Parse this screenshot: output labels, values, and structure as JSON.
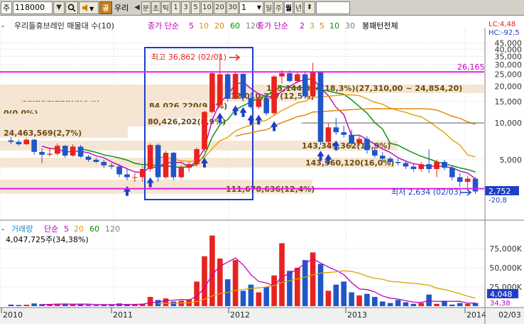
{
  "toolbar": {
    "market": "주",
    "code": "118000",
    "search_icon": "magnifier-icon",
    "sound_icon": "speaker-icon",
    "gong": "공",
    "name": "우리",
    "tabs": [
      "분",
      "초",
      "틱",
      "1",
      "3",
      "5",
      "10",
      "20",
      "30"
    ],
    "count": "1",
    "periods": [
      "일",
      "주",
      "월",
      "년"
    ],
    "active_period": "월"
  },
  "legend": {
    "title": "우리들휴브레인 매물대 수(10)",
    "ma_label": "종가 단순",
    "ma_periods": [
      "5",
      "10",
      "20",
      "60",
      "120"
    ],
    "ma_colors": [
      "#c000c0",
      "#d4a000",
      "#e08000",
      "#009000",
      "#808080"
    ],
    "ma2_label": "종가 단순",
    "ma2_periods": [
      "2",
      "3",
      "5",
      "10",
      "30"
    ],
    "pattern": "봉패턴전체",
    "lc": "LC:4,48",
    "hc": "HC:-92,5"
  },
  "volume_legend": {
    "title": "거래량",
    "ma_label": "단순",
    "periods": [
      "5",
      "20",
      "60",
      "120"
    ],
    "last": "4,047,725주(34,38%)"
  },
  "price_annotations": {
    "high": "최고 36,862 (02/01)",
    "low": "최저 2,634 (02/03)",
    "resistance": "26,165",
    "current": "2,752",
    "current_pct": "-20,8"
  },
  "volume_annotations": {
    "current": "4,048",
    "pct": "34,38"
  },
  "chart_data": [
    {
      "type": "candlestick",
      "title": "우리들휴브레인 매물대 수(10)",
      "y_axis": {
        "scale": "log",
        "tick_labels": [
          "45,000",
          "40,000",
          "35,000",
          "30,000",
          "25,000",
          "20,000",
          "15,000",
          "10,000",
          "5,000"
        ],
        "tick_values": [
          45000,
          40000,
          35000,
          30000,
          25000,
          20000,
          15000,
          10000,
          5000
        ]
      },
      "x_axis": {
        "labels": [
          "2010",
          "2011",
          "2012",
          "2013",
          "2014",
          "02/03"
        ]
      },
      "horizontal_lines": [
        26165,
        2900
      ],
      "volume_profile": [
        {
          "label": "34,814,606(3,9%)",
          "price": 20000
        },
        {
          "label": "84,026,220(9,3%)",
          "price": 18000
        },
        {
          "label": "0(0,0%)",
          "price": 16000
        },
        {
          "label": "80,426,202(8,9%)",
          "price": 14500
        },
        {
          "label": "24,463,569(2,7%)",
          "price": 11800
        },
        {
          "label": "143,349,362(15,9%)",
          "price": 9000
        },
        {
          "label": "143,960,120(16,0%)",
          "price": 6800
        },
        {
          "label": "111,678,636(12,4%)",
          "price": 3600
        },
        {
          "label": "112,010,237(12,5%)",
          "price": 21000
        },
        {
          "label": "165,144,614(18,3%)(27,310,00 ~ 24,854,20)",
          "price": 25800
        }
      ],
      "candles": [
        {
          "o": 7200,
          "h": 7600,
          "l": 6700,
          "c": 7000
        },
        {
          "o": 7000,
          "h": 7300,
          "l": 6500,
          "c": 6700
        },
        {
          "o": 6700,
          "h": 7500,
          "l": 6600,
          "c": 7300
        },
        {
          "o": 7300,
          "h": 7400,
          "l": 5500,
          "c": 5800
        },
        {
          "o": 5800,
          "h": 6200,
          "l": 4700,
          "c": 5500
        },
        {
          "o": 5500,
          "h": 6300,
          "l": 5300,
          "c": 5600
        },
        {
          "o": 5600,
          "h": 6800,
          "l": 5400,
          "c": 6500
        },
        {
          "o": 6500,
          "h": 6600,
          "l": 5200,
          "c": 5400
        },
        {
          "o": 5400,
          "h": 6700,
          "l": 5300,
          "c": 6400
        },
        {
          "o": 6400,
          "h": 6600,
          "l": 5200,
          "c": 5300
        },
        {
          "o": 5300,
          "h": 5500,
          "l": 4800,
          "c": 5000
        },
        {
          "o": 5000,
          "h": 5200,
          "l": 4700,
          "c": 4800
        },
        {
          "o": 4800,
          "h": 5000,
          "l": 4300,
          "c": 4500
        },
        {
          "o": 4500,
          "h": 4700,
          "l": 4200,
          "c": 4400
        },
        {
          "o": 4400,
          "h": 4600,
          "l": 3600,
          "c": 3800
        },
        {
          "o": 3800,
          "h": 4200,
          "l": 3400,
          "c": 3600
        },
        {
          "o": 3600,
          "h": 3900,
          "l": 3300,
          "c": 3600
        },
        {
          "o": 3600,
          "h": 4400,
          "l": 3300,
          "c": 4200
        },
        {
          "o": 4200,
          "h": 6800,
          "l": 4000,
          "c": 6600
        },
        {
          "o": 6600,
          "h": 6800,
          "l": 3300,
          "c": 3600
        },
        {
          "o": 3600,
          "h": 5900,
          "l": 3500,
          "c": 5700
        },
        {
          "o": 5700,
          "h": 5800,
          "l": 3400,
          "c": 3600
        },
        {
          "o": 3600,
          "h": 4500,
          "l": 3500,
          "c": 4300
        },
        {
          "o": 4300,
          "h": 4800,
          "l": 4000,
          "c": 4600
        },
        {
          "o": 4600,
          "h": 6300,
          "l": 4400,
          "c": 6100
        },
        {
          "o": 6100,
          "h": 12600,
          "l": 5800,
          "c": 12300
        },
        {
          "o": 12300,
          "h": 26000,
          "l": 12000,
          "c": 25500
        },
        {
          "o": 14000,
          "h": 36862,
          "l": 13500,
          "c": 25000
        },
        {
          "o": 25000,
          "h": 25500,
          "l": 15000,
          "c": 15800
        },
        {
          "o": 15800,
          "h": 26000,
          "l": 15500,
          "c": 25200
        },
        {
          "o": 25200,
          "h": 25500,
          "l": 15000,
          "c": 16000
        },
        {
          "o": 16000,
          "h": 17500,
          "l": 13000,
          "c": 13500
        },
        {
          "o": 13500,
          "h": 16500,
          "l": 13000,
          "c": 15800
        },
        {
          "o": 15800,
          "h": 17000,
          "l": 11500,
          "c": 12000
        },
        {
          "o": 12000,
          "h": 24500,
          "l": 11500,
          "c": 24000
        },
        {
          "o": 24000,
          "h": 27000,
          "l": 21000,
          "c": 25500
        },
        {
          "o": 25500,
          "h": 27000,
          "l": 21500,
          "c": 22000
        },
        {
          "o": 22000,
          "h": 26000,
          "l": 21000,
          "c": 25000
        },
        {
          "o": 25000,
          "h": 26500,
          "l": 16000,
          "c": 16500
        },
        {
          "o": 16500,
          "h": 31000,
          "l": 15500,
          "c": 26000
        },
        {
          "o": 26000,
          "h": 26500,
          "l": 6600,
          "c": 7000
        },
        {
          "o": 7000,
          "h": 10000,
          "l": 6200,
          "c": 9200
        },
        {
          "o": 9200,
          "h": 11000,
          "l": 8000,
          "c": 8400
        },
        {
          "o": 8400,
          "h": 9500,
          "l": 7600,
          "c": 8000
        },
        {
          "o": 8000,
          "h": 8800,
          "l": 6400,
          "c": 6800
        },
        {
          "o": 6800,
          "h": 7800,
          "l": 6500,
          "c": 7400
        },
        {
          "o": 7400,
          "h": 7800,
          "l": 5600,
          "c": 6000
        },
        {
          "o": 6000,
          "h": 6400,
          "l": 5200,
          "c": 5400
        },
        {
          "o": 5400,
          "h": 5800,
          "l": 4900,
          "c": 5100
        },
        {
          "o": 5100,
          "h": 5300,
          "l": 4700,
          "c": 4800
        },
        {
          "o": 4800,
          "h": 5100,
          "l": 4500,
          "c": 4700
        },
        {
          "o": 4700,
          "h": 4900,
          "l": 4200,
          "c": 4400
        },
        {
          "o": 4400,
          "h": 4600,
          "l": 4000,
          "c": 4200
        },
        {
          "o": 4200,
          "h": 4800,
          "l": 4000,
          "c": 4600
        },
        {
          "o": 4600,
          "h": 6100,
          "l": 3900,
          "c": 4200
        },
        {
          "o": 4200,
          "h": 5000,
          "l": 3600,
          "c": 4800
        },
        {
          "o": 4800,
          "h": 5000,
          "l": 4100,
          "c": 4300
        },
        {
          "o": 4300,
          "h": 4500,
          "l": 3400,
          "c": 3600
        },
        {
          "o": 3600,
          "h": 3900,
          "l": 3000,
          "c": 3300
        },
        {
          "o": 3300,
          "h": 3700,
          "l": 2900,
          "c": 3500
        },
        {
          "o": 3500,
          "h": 3600,
          "l": 2634,
          "c": 2752
        }
      ],
      "signal_arrows": [
        15,
        18,
        25,
        27,
        29,
        30,
        31,
        32,
        34,
        40,
        41,
        42
      ]
    },
    {
      "type": "bar",
      "title": "거래량",
      "y_axis": {
        "tick_labels": [
          "75,000K",
          "50,000K",
          "25,000K"
        ],
        "tick_values": [
          75000,
          50000,
          25000
        ]
      },
      "values": [
        2000,
        1500,
        1800,
        3500,
        2500,
        2000,
        3000,
        2800,
        2200,
        3000,
        1500,
        1200,
        2000,
        1800,
        3500,
        2500,
        1800,
        3000,
        12000,
        8000,
        10000,
        6000,
        7000,
        9000,
        32000,
        65000,
        92000,
        62000,
        35000,
        60000,
        20000,
        28000,
        18000,
        25000,
        40000,
        82000,
        46000,
        50000,
        60000,
        70000,
        55000,
        20000,
        28000,
        32000,
        18000,
        14000,
        16000,
        12000,
        6000,
        4000,
        8000,
        5000,
        3000,
        4000,
        15000,
        3000,
        7000,
        2000,
        4000,
        3000,
        4048
      ],
      "colors_rise": "#e8231f",
      "colors_fall": "#1f56c8"
    }
  ]
}
